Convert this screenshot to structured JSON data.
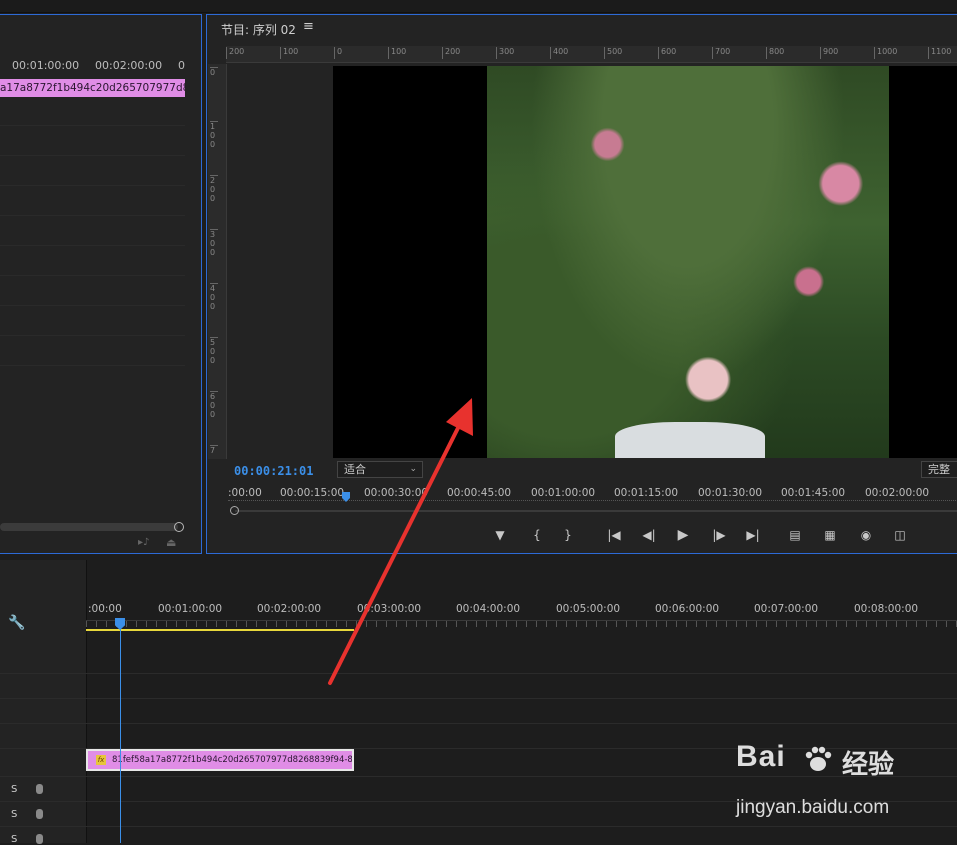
{
  "source": {
    "timecodes": [
      "00:01:00:00",
      "00:02:00:00",
      "0"
    ],
    "clip_name": "a17a8772f1b494c20d265707977d826"
  },
  "program": {
    "title": "节目: 序列 02",
    "menu_glyph": "≡",
    "ruler_top": [
      "200",
      "100",
      "0",
      "100",
      "200",
      "300",
      "400",
      "500",
      "600",
      "700",
      "800",
      "900",
      "1000",
      "1100"
    ],
    "ruler_left": [
      "0",
      "1 0 0",
      "2 0 0",
      "3 0 0",
      "4 0 0",
      "5 0 0",
      "6 0 0",
      "7"
    ],
    "timecode": "00:00:21:01",
    "fit_label": "适合",
    "quality_label": "完整",
    "mini_ruler": [
      ":00:00",
      "00:00:15:00",
      "00:00:30:00",
      "00:00:45:00",
      "00:01:00:00",
      "00:01:15:00",
      "00:01:30:00",
      "00:01:45:00",
      "00:02:00:00"
    ],
    "controls": [
      "marker-icon",
      "mark-in-icon",
      "mark-out-icon",
      "go-to-in-icon",
      "step-back-icon",
      "play-icon",
      "step-forward-icon",
      "go-to-out-icon",
      "lift-icon",
      "extract-icon",
      "camera-icon",
      "button-editor-icon"
    ]
  },
  "timeline": {
    "timestamps": [
      ":00:00",
      "00:01:00:00",
      "00:02:00:00",
      "00:03:00:00",
      "00:04:00:00",
      "00:05:00:00",
      "00:06:00:00",
      "00:07:00:00",
      "00:08:00:00"
    ],
    "clip_name": "81fef58a17a8772f1b494c20d265707977d8268839f94-8a",
    "fx_badge": "fx",
    "track_s": [
      "S",
      "S",
      "S"
    ]
  },
  "watermark": {
    "logo": "Bai",
    "logo_cn": "经验",
    "url": "jingyan.baidu.com"
  },
  "colors": {
    "accent_blue": "#3b8fe8",
    "clip_pink": "#e08de6",
    "work_area_yellow": "#e8d83c",
    "arrow_red": "#e8322e"
  }
}
